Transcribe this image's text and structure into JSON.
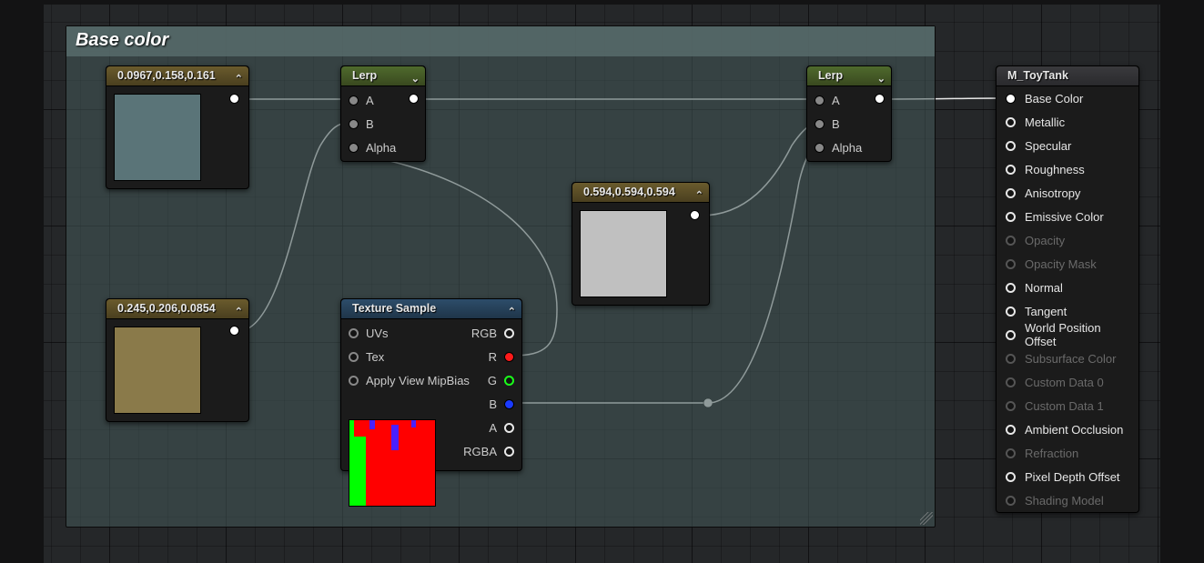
{
  "comment": {
    "title": "Base color"
  },
  "nodes": {
    "const1": {
      "title": "0.0967,0.158,0.161",
      "swatch": "#5a7478"
    },
    "const2": {
      "title": "0.245,0.206,0.0854",
      "swatch": "#8a7a4a"
    },
    "const3": {
      "title": "0.594,0.594,0.594",
      "swatch": "#c0c0c0"
    },
    "lerp1": {
      "title": "Lerp",
      "inputs": [
        "A",
        "B",
        "Alpha"
      ]
    },
    "lerp2": {
      "title": "Lerp",
      "inputs": [
        "A",
        "B",
        "Alpha"
      ]
    },
    "tex": {
      "title": "Texture Sample",
      "inputs": [
        "UVs",
        "Tex",
        "Apply View MipBias"
      ],
      "outputs": [
        "RGB",
        "R",
        "G",
        "B",
        "A",
        "RGBA"
      ]
    }
  },
  "material": {
    "title": "M_ToyTank",
    "pins": [
      {
        "label": "Base Color",
        "enabled": true,
        "connected": true
      },
      {
        "label": "Metallic",
        "enabled": true
      },
      {
        "label": "Specular",
        "enabled": true
      },
      {
        "label": "Roughness",
        "enabled": true
      },
      {
        "label": "Anisotropy",
        "enabled": true
      },
      {
        "label": "Emissive Color",
        "enabled": true
      },
      {
        "label": "Opacity",
        "enabled": false
      },
      {
        "label": "Opacity Mask",
        "enabled": false
      },
      {
        "label": "Normal",
        "enabled": true
      },
      {
        "label": "Tangent",
        "enabled": true
      },
      {
        "label": "World Position Offset",
        "enabled": true
      },
      {
        "label": "Subsurface Color",
        "enabled": false
      },
      {
        "label": "Custom Data 0",
        "enabled": false
      },
      {
        "label": "Custom Data 1",
        "enabled": false
      },
      {
        "label": "Ambient Occlusion",
        "enabled": true
      },
      {
        "label": "Refraction",
        "enabled": false
      },
      {
        "label": "Pixel Depth Offset",
        "enabled": true
      },
      {
        "label": "Shading Model",
        "enabled": false
      }
    ]
  },
  "glyphs": {
    "up": "⌃",
    "down": "⌄"
  }
}
